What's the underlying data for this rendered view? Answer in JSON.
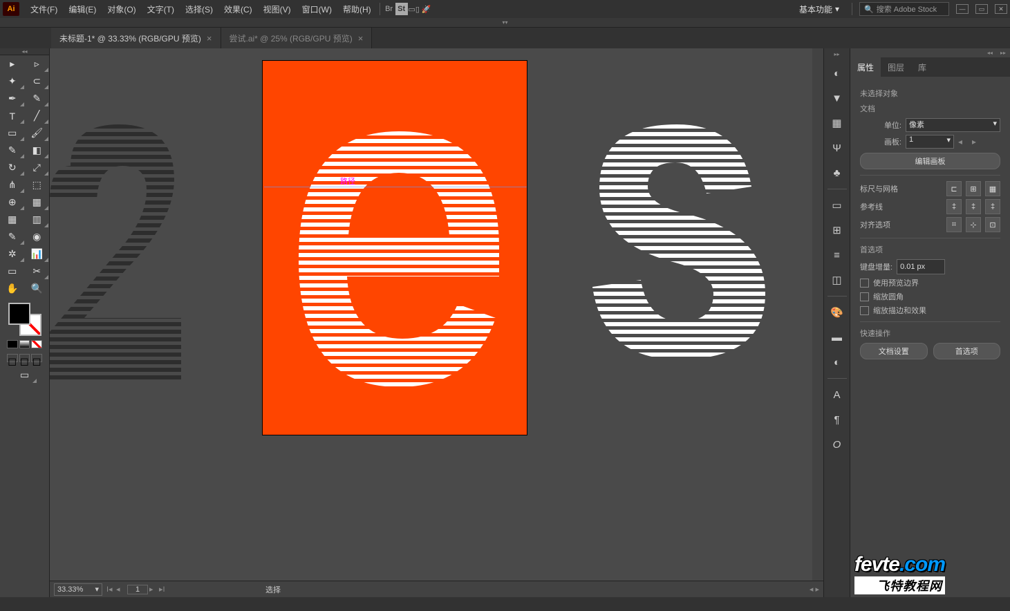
{
  "app": {
    "logo": "Ai"
  },
  "menu": [
    "文件(F)",
    "编辑(E)",
    "对象(O)",
    "文字(T)",
    "选择(S)",
    "效果(C)",
    "视图(V)",
    "窗口(W)",
    "帮助(H)"
  ],
  "topbar": {
    "workspace": "基本功能",
    "search_placeholder": "搜索 Adobe Stock"
  },
  "tabs": [
    {
      "label": "未标题-1* @ 33.33% (RGB/GPU 预览)",
      "active": true
    },
    {
      "label": "尝试.ai* @ 25% (RGB/GPU 预览)",
      "active": false
    }
  ],
  "canvas": {
    "smart_guide_label": "路径"
  },
  "properties": {
    "panel_tabs": [
      "属性",
      "图层",
      "库"
    ],
    "no_selection": "未选择对象",
    "doc_section": "文档",
    "units_label": "单位:",
    "units_value": "像素",
    "artboard_label": "画板:",
    "artboard_value": "1",
    "edit_artboard": "编辑画板",
    "ruler_grid": "标尺与网格",
    "guides": "参考线",
    "align_options": "对齐选项",
    "prefs_section": "首选项",
    "key_increment_label": "键盘增量:",
    "key_increment_value": "0.01 px",
    "use_preview_bounds": "使用预览边界",
    "scale_corners": "缩放圆角",
    "scale_strokes": "缩放描边和效果",
    "quick_actions": "快速操作",
    "doc_setup": "文档设置",
    "prefs_btn": "首选项"
  },
  "status": {
    "zoom": "33.33%",
    "page": "1",
    "tool": "选择"
  },
  "watermark": {
    "line1a": "fevte",
    "line1b": ".com",
    "line2": "飞特教程网"
  }
}
